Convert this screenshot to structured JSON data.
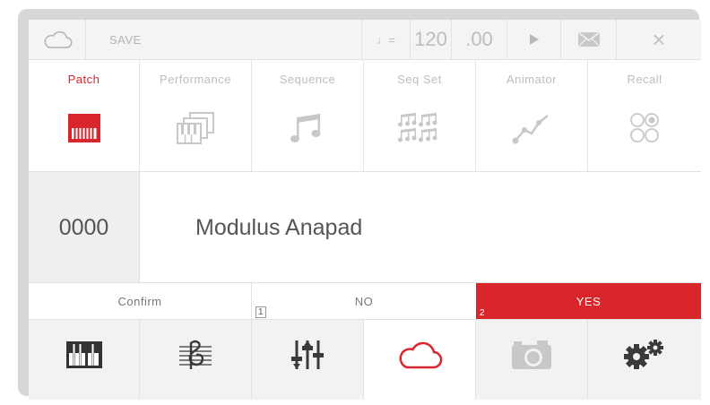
{
  "topbar": {
    "save_label": "SAVE",
    "note_symbol": "♩=",
    "tempo": "120",
    "tempo_fraction": ".00",
    "close_symbol": "×",
    "icons": [
      "cloud-icon",
      "play-icon",
      "mail-icon",
      "close-icon"
    ]
  },
  "modes": {
    "active": "Patch",
    "items": [
      {
        "label": "Patch",
        "icon": "piano-keys-icon"
      },
      {
        "label": "Performance",
        "icon": "layered-keys-icon"
      },
      {
        "label": "Sequence",
        "icon": "music-notes-icon"
      },
      {
        "label": "Seq Set",
        "icon": "note-grid-icon"
      },
      {
        "label": "Animator",
        "icon": "curve-icon"
      },
      {
        "label": "Recall",
        "icon": "recall-circles-icon"
      }
    ]
  },
  "patch": {
    "number": "0000",
    "name": "Modulus Anapad"
  },
  "confirm": {
    "label": "Confirm",
    "no_label": "NO",
    "no_index": "1",
    "yes_label": "YES",
    "yes_index": "2"
  },
  "bottom_nav": {
    "active": "cloud",
    "icons": [
      "piano-keys-icon",
      "staff-icon",
      "sliders-icon",
      "cloud-icon",
      "camera-icon",
      "gears-icon"
    ]
  },
  "colors": {
    "accent": "#d9262c",
    "frame": "#d7d7d7",
    "inactive_icon": "#c4c4c4",
    "dark_icon": "#3a3a3a"
  }
}
